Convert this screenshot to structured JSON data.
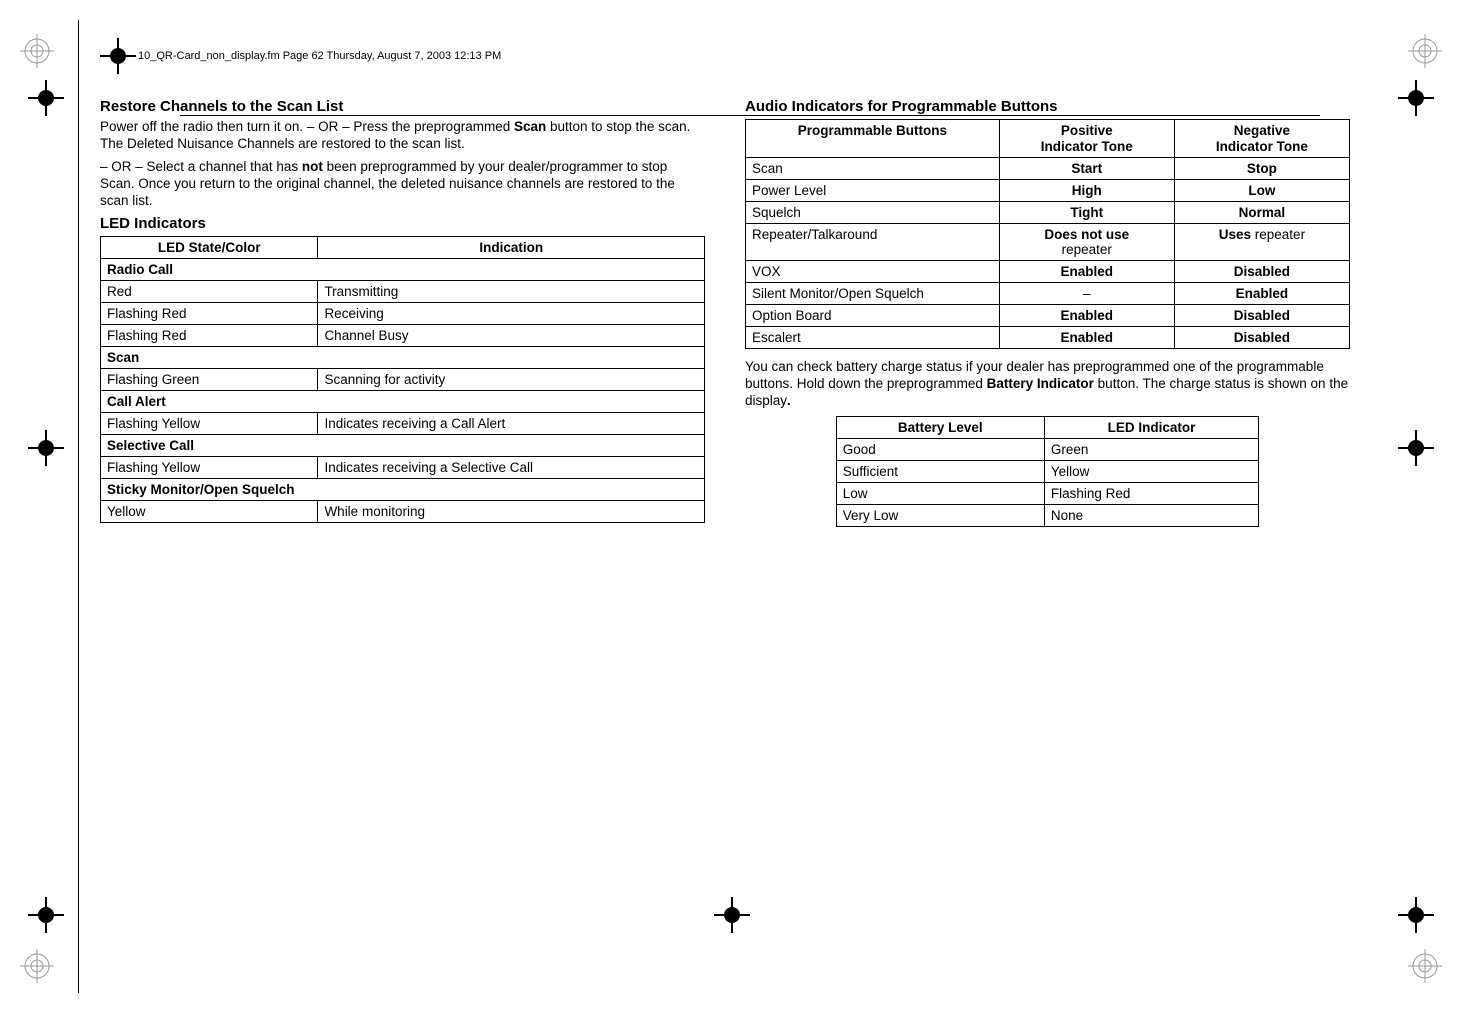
{
  "header": "10_QR-Card_non_display.fm  Page 62  Thursday, August 7, 2003  12:13 PM",
  "left": {
    "h_restore": "Restore Channels to the Scan List",
    "p_restore_1a": "Power off the radio then turn it on. – OR – Press the preprogrammed ",
    "p_restore_1b": "Scan",
    "p_restore_1c": " button to stop the scan. The Deleted Nuisance Channels are restored to the scan list.",
    "p_restore_2a": "– OR – Select a channel that has ",
    "p_restore_2b": "not",
    "p_restore_2c": " been preprogrammed by your dealer/programmer to stop Scan. Once you return to the original channel, the deleted nuisance channels are restored to the scan list.",
    "h_led": "LED Indicators",
    "led_head_state": "LED State/Color",
    "led_head_ind": "Indication",
    "led_rows": [
      {
        "type": "section",
        "a": "Radio Call"
      },
      {
        "type": "row",
        "a": "Red",
        "b": "Transmitting"
      },
      {
        "type": "row",
        "a": "Flashing Red",
        "b": "Receiving"
      },
      {
        "type": "row",
        "a": "Flashing Red",
        "b": "Channel Busy"
      },
      {
        "type": "section",
        "a": "Scan"
      },
      {
        "type": "row",
        "a": "Flashing Green",
        "b": "Scanning for activity"
      },
      {
        "type": "section",
        "a": "Call Alert"
      },
      {
        "type": "row",
        "a": "Flashing Yellow",
        "b": "Indicates receiving a Call Alert"
      },
      {
        "type": "section",
        "a": "Selective Call"
      },
      {
        "type": "row",
        "a": "Flashing Yellow",
        "b": "Indicates receiving a Selective Call"
      },
      {
        "type": "section",
        "a": "Sticky Monitor/Open Squelch"
      },
      {
        "type": "row",
        "a": "Yellow",
        "b": "While monitoring"
      }
    ]
  },
  "right": {
    "h_audio": "Audio Indicators for Programmable Buttons",
    "audio_head_btn": "Programmable Buttons",
    "audio_head_pos1": "Positive",
    "audio_head_pos2": "Indicator Tone",
    "audio_head_neg1": "Negative",
    "audio_head_neg2": "Indicator Tone",
    "audio_rows": [
      {
        "a": "Scan",
        "b": "Start",
        "c": "Stop",
        "bb": true,
        "cb": true
      },
      {
        "a": "Power Level",
        "b": "High",
        "c": "Low",
        "bb": true,
        "cb": true
      },
      {
        "a": "Squelch",
        "b": "Tight",
        "c": "Normal",
        "bb": true,
        "cb": true
      },
      {
        "a": "Repeater/Talkaround",
        "b_html": "<span class='bold'>Does not use</span><br>repeater",
        "c_html": "<span class='bold'>Uses</span> repeater"
      },
      {
        "a": "VOX",
        "b": "Enabled",
        "c": "Disabled",
        "bb": true,
        "cb": true
      },
      {
        "a": "Silent Monitor/Open Squelch",
        "b": "–",
        "c": "Enabled",
        "cb": true
      },
      {
        "a": "Option Board",
        "b": "Enabled",
        "c": "Disabled",
        "bb": true,
        "cb": true
      },
      {
        "a": "Escalert",
        "b": "Enabled",
        "c": "Disabled",
        "bb": true,
        "cb": true
      }
    ],
    "p_batt_1": "You can check battery charge status if your dealer has preprogrammed one of the programmable buttons. Hold down the preprogrammed ",
    "p_batt_2": "Battery Indicator",
    "p_batt_3": " button. The charge status is shown on the display",
    "p_batt_4": ".",
    "batt_head_level": "Battery Level",
    "batt_head_led": "LED Indicator",
    "batt_rows": [
      {
        "a": "Good",
        "b": "Green"
      },
      {
        "a": "Sufficient",
        "b": "Yellow"
      },
      {
        "a": "Low",
        "b": "Flashing Red"
      },
      {
        "a": "Very Low",
        "b": "None"
      }
    ]
  }
}
